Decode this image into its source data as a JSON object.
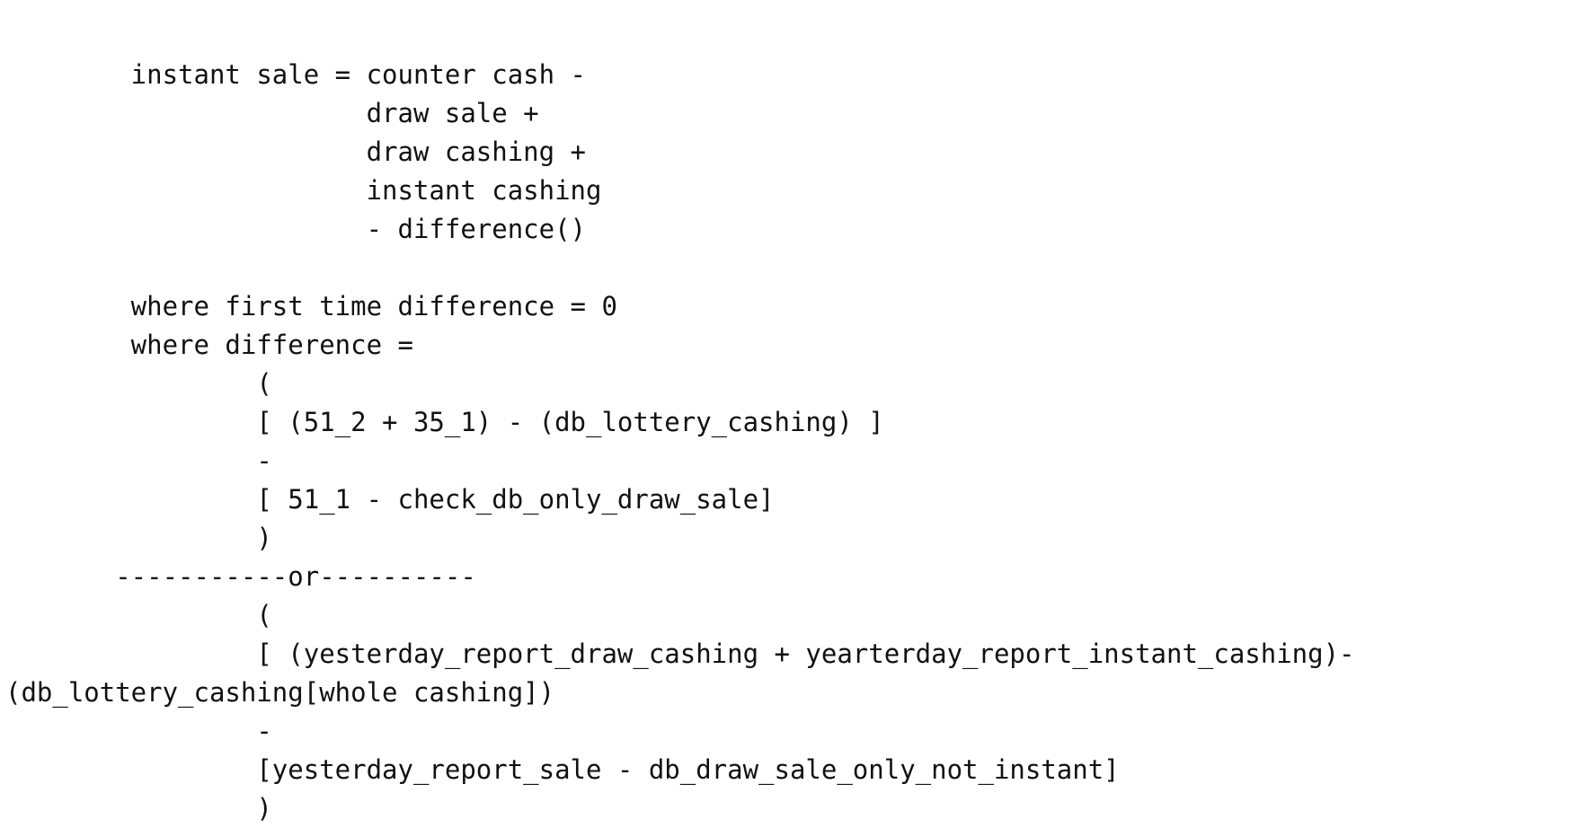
{
  "document": {
    "lines": [
      "        instant sale = counter cash -",
      "                       draw sale +",
      "                       draw cashing +",
      "                       instant cashing",
      "                       - difference()",
      "",
      "        where first time difference = 0",
      "        where difference =",
      "                ( ",
      "                [ (51_2 + 35_1) - (db_lottery_cashing) ]",
      "                -",
      "                [ 51_1 - check_db_only_draw_sale]",
      "                )",
      "       -----------or----------",
      "                (",
      "                [ (yesterday_report_draw_cashing + yearterday_report_instant_cashing)-",
      "(db_lottery_cashing[whole cashing])",
      "                -",
      "                [yesterday_report_sale - db_draw_sale_only_not_instant]",
      "                )"
    ]
  }
}
